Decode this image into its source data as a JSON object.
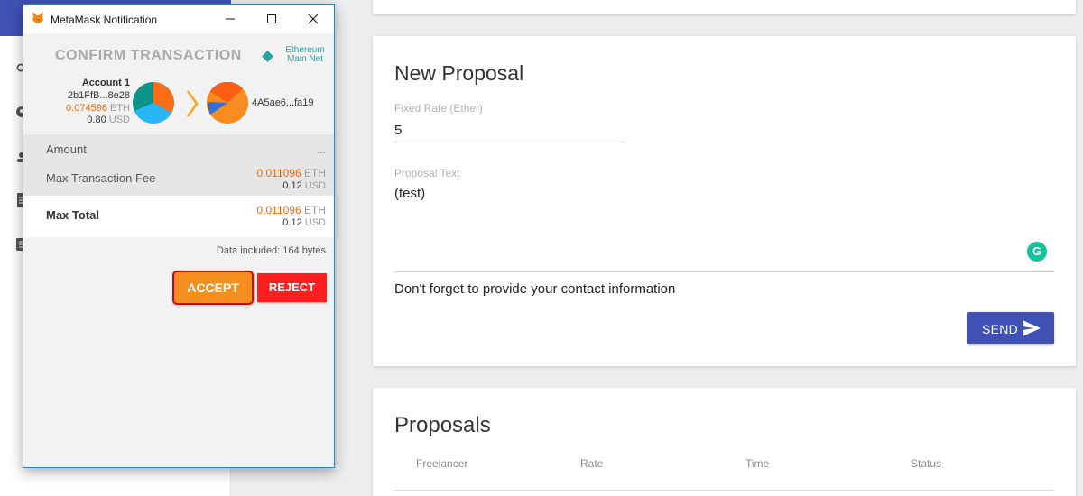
{
  "background_app": {
    "sidebar": {
      "icons": [
        "search-icon",
        "account-icon",
        "person-icon",
        "document-icon",
        "list-icon"
      ]
    },
    "new_proposal": {
      "title": "New Proposal",
      "fixed_rate_label": "Fixed Rate (Ether)",
      "fixed_rate_value": "5",
      "proposal_text_label": "Proposal Text",
      "proposal_text_value": "(test)",
      "hint": "Don't forget to provide your contact information",
      "send_label": "SEND"
    },
    "proposals": {
      "title": "Proposals",
      "columns": [
        "Freelancer",
        "Rate",
        "Time",
        "Status"
      ]
    },
    "colors": {
      "primary": "#3f51b5",
      "grammarly": "#15c39a"
    }
  },
  "metamask": {
    "window_title": "MetaMask Notification",
    "confirm_title": "CONFIRM TRANSACTION",
    "network": [
      "Ethereum",
      "Main Net"
    ],
    "from": {
      "account": "Account 1",
      "address": "2b1FfB...8e28",
      "eth_amount": "0.074596",
      "eth_unit": "ETH",
      "usd_amount": "0.80",
      "usd_unit": "USD"
    },
    "to": {
      "address": "4A5ae6...fa19"
    },
    "rows": {
      "amount_label": "Amount",
      "amount_value": "...",
      "fee_label": "Max Transaction Fee",
      "fee_eth": "0.011096",
      "fee_eth_unit": "ETH",
      "fee_usd": "0.12",
      "fee_usd_unit": "USD",
      "total_label": "Max Total",
      "total_eth": "0.011096",
      "total_eth_unit": "ETH",
      "total_usd": "0.12",
      "total_usd_unit": "USD"
    },
    "data_note": "Data included: 164 bytes",
    "accept_label": "ACCEPT",
    "reject_label": "REJECT",
    "colors": {
      "orange": "#f66a0a",
      "teal": "#2aa1a1",
      "accept": "#f48f1f",
      "reject": "#ff1f1f"
    }
  }
}
